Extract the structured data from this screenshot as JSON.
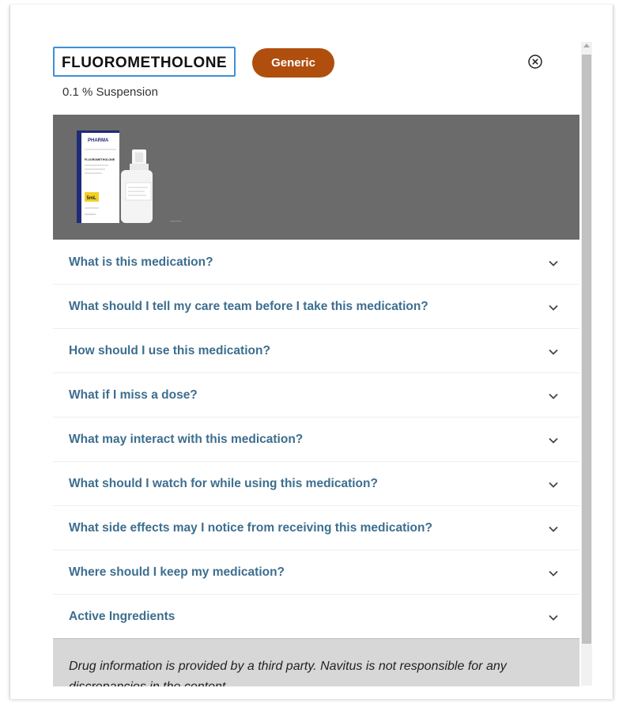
{
  "header": {
    "drug_name": "FLUOROMETHOLONE",
    "badge_label": "Generic",
    "subtitle": "0.1 % Suspension",
    "close_icon": "circle-x-icon"
  },
  "product_image": {
    "box_brand": "PHARMA",
    "box_name": "FLUOROMETHOLONE",
    "box_desc": "ophthalmic suspension, USP 0.1%",
    "box_volume": "5mL"
  },
  "accordion": {
    "items": [
      {
        "label": "What is this medication?"
      },
      {
        "label": "What should I tell my care team before I take this medication?"
      },
      {
        "label": "How should I use this medication?"
      },
      {
        "label": "What if I miss a dose?"
      },
      {
        "label": "What may interact with this medication?"
      },
      {
        "label": "What should I watch for while using this medication?"
      },
      {
        "label": "What side effects may I notice from receiving this medication?"
      },
      {
        "label": "Where should I keep my medication?"
      },
      {
        "label": "Active Ingredients"
      }
    ],
    "expand_icon": "chevron-down-icon"
  },
  "footer": {
    "disclaimer": "Drug information is provided by a third party. Navitus is not responsible for any discrepancies in the content."
  },
  "colors": {
    "badge": "#b04e0e",
    "question_text": "#3d6e8f",
    "title_border": "#3f8fd8",
    "image_bg": "#6b6b6b",
    "footer_bg": "#d7d7d7"
  }
}
